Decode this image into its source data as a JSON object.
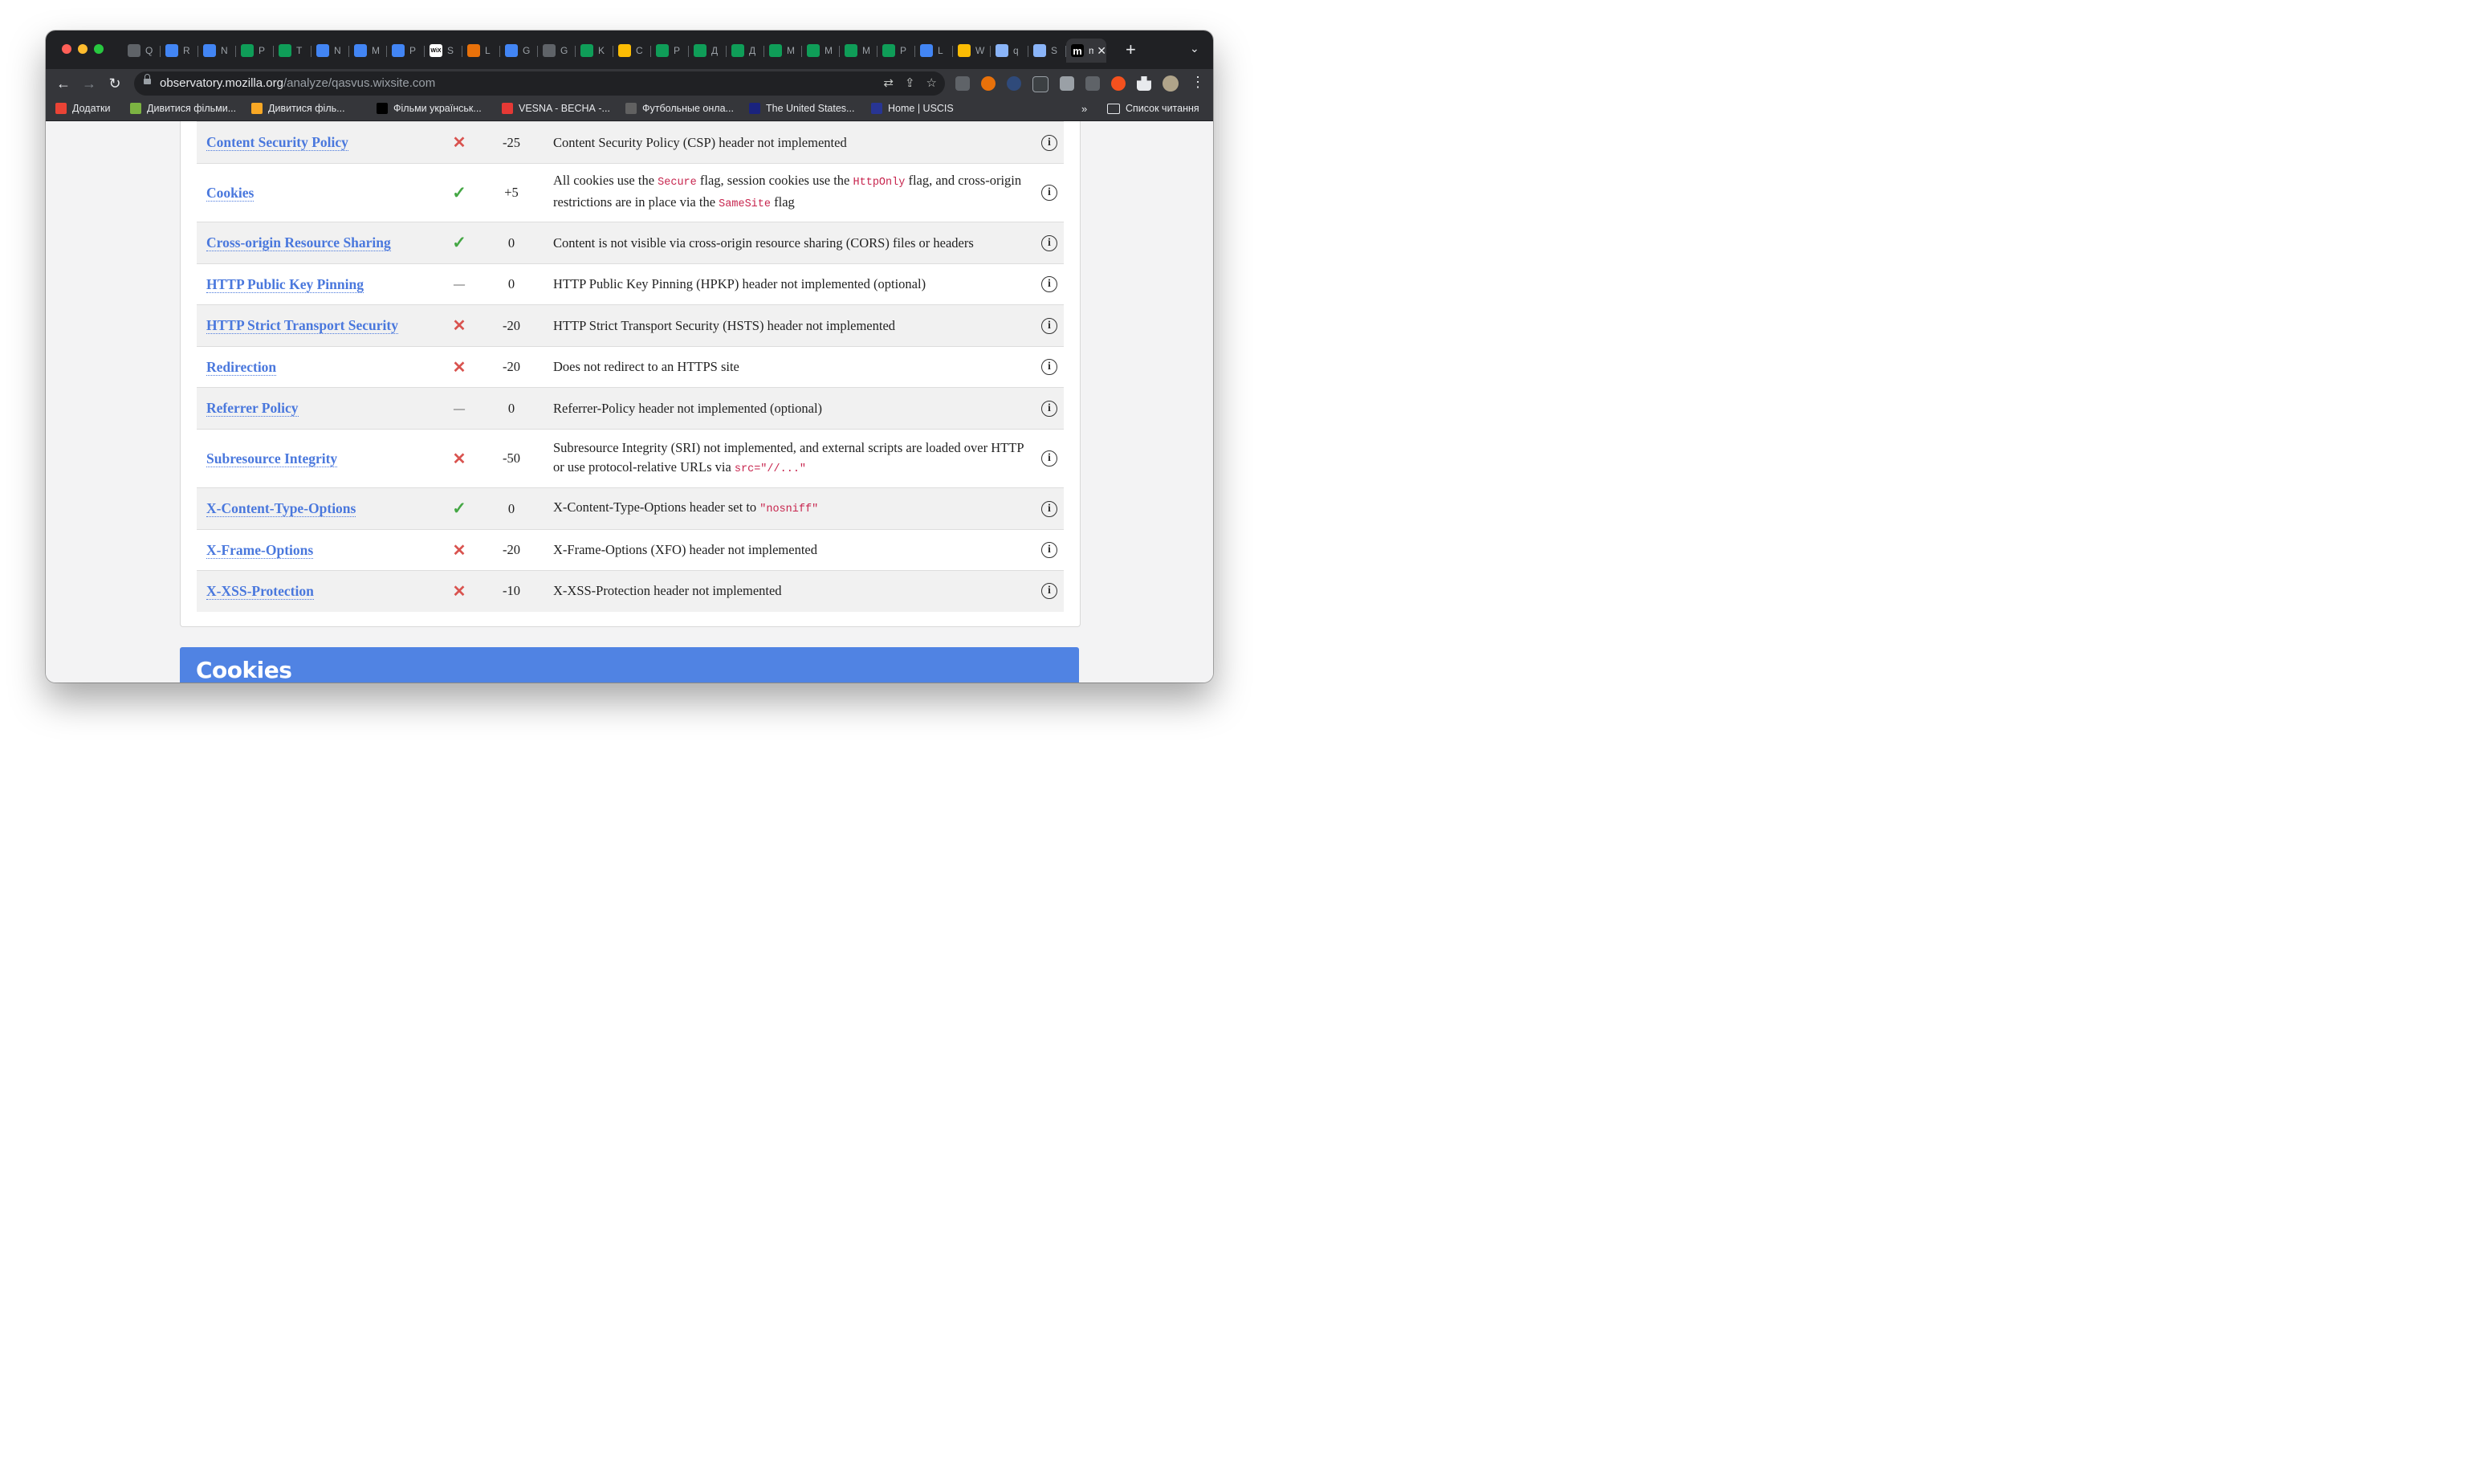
{
  "browser": {
    "tabs": [
      {
        "label": "Q",
        "icon": "contacts-icon",
        "color": "#5f6368"
      },
      {
        "label": "R",
        "icon": "google-docs-icon",
        "color": "#4285f4"
      },
      {
        "label": "N",
        "icon": "google-docs-icon",
        "color": "#4285f4"
      },
      {
        "label": "P",
        "icon": "google-sheets-icon",
        "color": "#0f9d58"
      },
      {
        "label": "T",
        "icon": "google-sheets-icon",
        "color": "#0f9d58"
      },
      {
        "label": "N",
        "icon": "google-docs-icon",
        "color": "#4285f4"
      },
      {
        "label": "M",
        "icon": "google-docs-icon",
        "color": "#4285f4"
      },
      {
        "label": "P",
        "icon": "google-docs-icon",
        "color": "#4285f4"
      },
      {
        "label": "S",
        "icon": "wix-icon",
        "color": "#ffffff"
      },
      {
        "label": "L",
        "icon": "person-icon",
        "color": "#e8710a"
      },
      {
        "label": "G",
        "icon": "translate-icon",
        "color": "#4285f4"
      },
      {
        "label": "G",
        "icon": "contacts-icon",
        "color": "#5f6368"
      },
      {
        "label": "K",
        "icon": "google-sheets-icon",
        "color": "#0f9d58"
      },
      {
        "label": "C",
        "icon": "google-drive-icon",
        "color": "#fbbc04"
      },
      {
        "label": "P",
        "icon": "google-sheets-icon",
        "color": "#0f9d58"
      },
      {
        "label": "Д",
        "icon": "google-sheets-icon",
        "color": "#0f9d58"
      },
      {
        "label": "Д",
        "icon": "google-sheets-icon",
        "color": "#0f9d58"
      },
      {
        "label": "M",
        "icon": "google-sheets-icon",
        "color": "#0f9d58"
      },
      {
        "label": "M",
        "icon": "google-sheets-icon",
        "color": "#0f9d58"
      },
      {
        "label": "M",
        "icon": "google-sheets-icon",
        "color": "#0f9d58"
      },
      {
        "label": "P",
        "icon": "google-sheets-icon",
        "color": "#0f9d58"
      },
      {
        "label": "L",
        "icon": "gt-icon",
        "color": "#4285f4"
      },
      {
        "label": "W",
        "icon": "chrome-icon",
        "color": "#fbbc04"
      },
      {
        "label": "q",
        "icon": "compass-icon",
        "color": "#8ab4f8"
      },
      {
        "label": "S",
        "icon": "cat-icon",
        "color": "#8ab4f8"
      },
      {
        "label": "m",
        "icon": "mozilla-icon",
        "color": "#000000"
      }
    ],
    "new_tab_label": "+",
    "url_host": "observatory.mozilla.org",
    "url_path": "/analyze/qasvus.wixsite.com",
    "bookmarks": [
      {
        "label": "Додатки",
        "icon": "apps-icon",
        "color": "#ea4335"
      },
      {
        "label": "Дивитися фільми...",
        "icon": "bookmark-film-icon",
        "color": "#7cb342"
      },
      {
        "label": "Дивитися філь...",
        "icon": "bookmark-ua-icon",
        "color": "#f9a825"
      },
      {
        "label": "Фільми українськ...",
        "icon": "bookmark-k-icon",
        "color": "#000000"
      },
      {
        "label": "VESNA - ВЕСНА -...",
        "icon": "bookmark-vesna-icon",
        "color": "#e53935"
      },
      {
        "label": "Футбольные онла...",
        "icon": "soccer-ball-icon",
        "color": "#616161"
      },
      {
        "label": "The United States...",
        "icon": "ssa-icon",
        "color": "#1a237e"
      },
      {
        "label": "Home | USCIS",
        "icon": "uscis-icon",
        "color": "#283593"
      }
    ],
    "bookmarks_more": "»",
    "reading_list": "Список читання"
  },
  "results": [
    {
      "test": "Content Security Policy",
      "pass": "fail",
      "score": "-25",
      "explanation": [
        {
          "t": "Content Security Policy (CSP) header not implemented"
        }
      ]
    },
    {
      "test": "Cookies",
      "pass": "pass",
      "score": "+5",
      "explanation": [
        {
          "t": "All cookies use the "
        },
        {
          "c": "Secure"
        },
        {
          "t": " flag, session cookies use the "
        },
        {
          "c": "HttpOnly"
        },
        {
          "t": " flag, and cross-origin restrictions are in place via the "
        },
        {
          "c": "SameSite"
        },
        {
          "t": " flag"
        }
      ]
    },
    {
      "test": "Cross-origin Resource Sharing",
      "pass": "pass",
      "score": "0",
      "explanation": [
        {
          "t": "Content is not visible via cross-origin resource sharing (CORS) files or headers"
        }
      ]
    },
    {
      "test": "HTTP Public Key Pinning",
      "pass": "neutral",
      "score": "0",
      "explanation": [
        {
          "t": "HTTP Public Key Pinning (HPKP) header not implemented (optional)"
        }
      ]
    },
    {
      "test": "HTTP Strict Transport Security",
      "pass": "fail",
      "score": "-20",
      "explanation": [
        {
          "t": "HTTP Strict Transport Security (HSTS) header not implemented"
        }
      ]
    },
    {
      "test": "Redirection",
      "pass": "fail",
      "score": "-20",
      "explanation": [
        {
          "t": "Does not redirect to an HTTPS site"
        }
      ]
    },
    {
      "test": "Referrer Policy",
      "pass": "neutral",
      "score": "0",
      "explanation": [
        {
          "t": "Referrer-Policy header not implemented (optional)"
        }
      ]
    },
    {
      "test": "Subresource Integrity",
      "pass": "fail",
      "score": "-50",
      "explanation": [
        {
          "t": "Subresource Integrity (SRI) not implemented, and external scripts are loaded over HTTP or use protocol-relative URLs via "
        },
        {
          "c": "src=\"//...\""
        }
      ]
    },
    {
      "test": "X-Content-Type-Options",
      "pass": "pass",
      "score": "0",
      "explanation": [
        {
          "t": "X-Content-Type-Options header set to "
        },
        {
          "c": "\"nosniff\""
        }
      ]
    },
    {
      "test": "X-Frame-Options",
      "pass": "fail",
      "score": "-20",
      "explanation": [
        {
          "t": "X-Frame-Options (XFO) header not implemented"
        }
      ]
    },
    {
      "test": "X-XSS-Protection",
      "pass": "fail",
      "score": "-10",
      "explanation": [
        {
          "t": "X-XSS-Protection header not implemented"
        }
      ]
    }
  ],
  "status_colors": {
    "pass": "#44a744",
    "fail": "#d9534f",
    "neutral": "#666666"
  },
  "next_section_title": "Cookies"
}
